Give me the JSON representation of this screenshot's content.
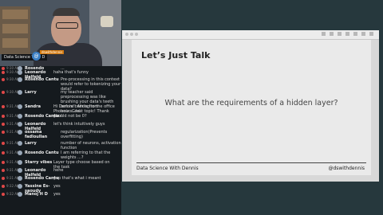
{
  "webcam": {
    "label": "Data Science With D",
    "logo_text": "@",
    "badge": "dswithdennis"
  },
  "chat": [
    {
      "time": "9:30 AM",
      "user": "Rosendo",
      "text": "...",
      "style": "top"
    },
    {
      "time": "9:30 AM",
      "user": "Leonardo Halfeld",
      "text": "haha that's funny",
      "style": "inline"
    },
    {
      "time": "9:30 AM",
      "user": "Rosendo Cantu",
      "text": "Pre-processing in this context would refer to tokenizing your data?"
    },
    {
      "time": "9:30 AM",
      "user": "Larry",
      "text": "my teacher said preprocessing was like brushing your data's teeth before coming to the office hours...lol"
    },
    {
      "time": "9:31 AM",
      "user": "Sandra",
      "text": "Hi Dennis!! Alicia from Phoenix. Great topic! Thank you!",
      "style": "inline"
    },
    {
      "time": "9:31 AM",
      "user": "Rosendo Cantu",
      "text": "should not be 0?",
      "style": "inline"
    },
    {
      "time": "9:31 AM",
      "user": "Leonardo Halfeld",
      "text": "let's think intuitively guys",
      "style": "inline"
    },
    {
      "time": "9:31 AM",
      "user": "ossama fadloullan",
      "text": "regularization(Prevents overfitting)"
    },
    {
      "time": "9:31 AM",
      "user": "Larry",
      "text": "number of neurons, activation function"
    },
    {
      "time": "9:31 AM",
      "user": "Rosendo Cantu",
      "text": "I am referring to that the weights ...?"
    },
    {
      "time": "9:31 AM",
      "user": "Starry vibes",
      "text": "Layer type choose based on the task",
      "style": "inline"
    },
    {
      "time": "9:31 AM",
      "user": "Leonardo Halfeld",
      "text": "hehe",
      "style": "inline"
    },
    {
      "time": "9:31 AM",
      "user": "Rosendo Cantu",
      "text": "yep that's what i meant",
      "style": "inline"
    },
    {
      "time": "9:32 AM",
      "user": "Yassine Es-saoudy",
      "text": "yes",
      "style": "inline"
    },
    {
      "time": "9:32 AM",
      "user": "Manoj H D",
      "text": "yes",
      "style": "inline"
    }
  ],
  "slide": {
    "title": "Let’s Just Talk",
    "question": "What are the requirements of a hidden layer?",
    "footer_left": "Data Science With Dennis",
    "footer_right": "@dswithdennis"
  }
}
